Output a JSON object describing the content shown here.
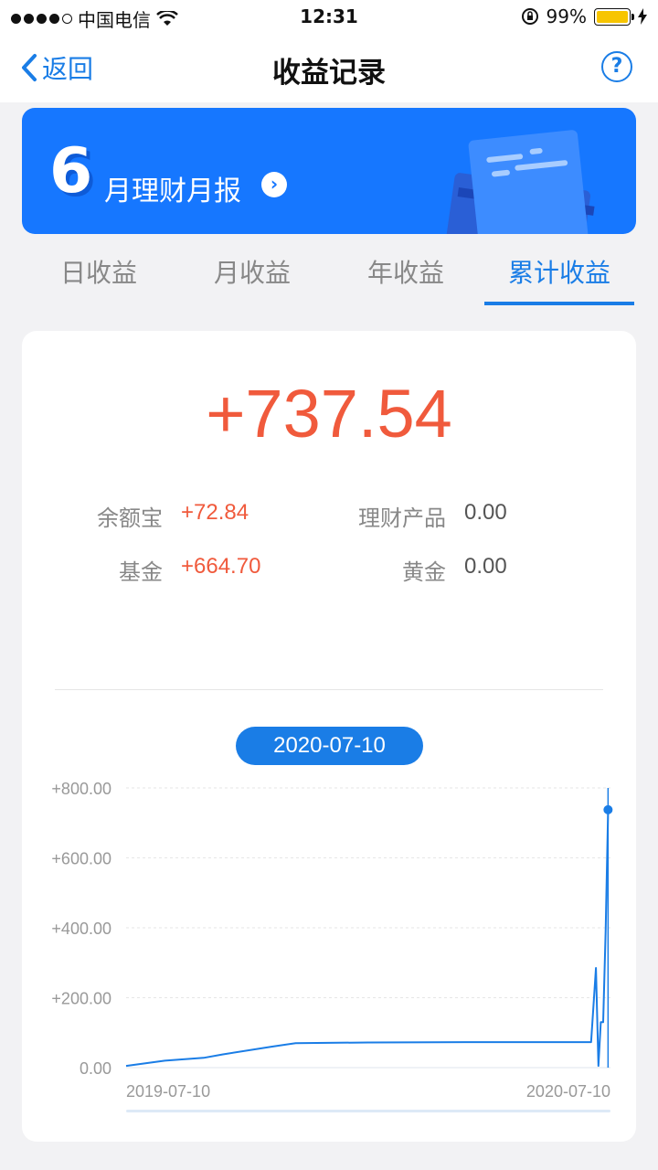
{
  "status": {
    "carrier": "中国电信",
    "time": "12:31",
    "battery": "99%"
  },
  "nav": {
    "back": "返回",
    "title": "收益记录",
    "help": "?"
  },
  "banner": {
    "number": "6",
    "text": "月理财月报",
    "arrow": "›"
  },
  "tabs": [
    "日收益",
    "月收益",
    "年收益",
    "累计收益"
  ],
  "active_tab": 3,
  "summary": {
    "total": "+737.54",
    "items": [
      {
        "label": "余额宝",
        "value": "+72.84"
      },
      {
        "label": "理财产品",
        "value": "0.00"
      },
      {
        "label": "基金",
        "value": "+664.70"
      },
      {
        "label": "黄金",
        "value": "0.00"
      }
    ]
  },
  "selected_date": "2020-07-10",
  "chart_data": {
    "type": "line",
    "y_ticks": [
      "+800.00",
      "+600.00",
      "+400.00",
      "+200.00",
      "0.00"
    ],
    "ylim": [
      0,
      800
    ],
    "x_labels": [
      "2019-07-10",
      "2020-07-10"
    ],
    "points": [
      [
        0,
        5
      ],
      [
        0.08,
        20
      ],
      [
        0.16,
        28
      ],
      [
        0.2,
        38
      ],
      [
        0.3,
        60
      ],
      [
        0.35,
        70
      ],
      [
        0.5,
        72
      ],
      [
        0.7,
        73
      ],
      [
        0.96,
        73
      ],
      [
        0.97,
        285
      ],
      [
        0.975,
        5
      ],
      [
        0.98,
        130
      ],
      [
        0.985,
        130
      ],
      [
        0.99,
        390
      ],
      [
        0.995,
        737.54
      ]
    ],
    "highlight": 737.54,
    "color": "#1a7de6"
  }
}
